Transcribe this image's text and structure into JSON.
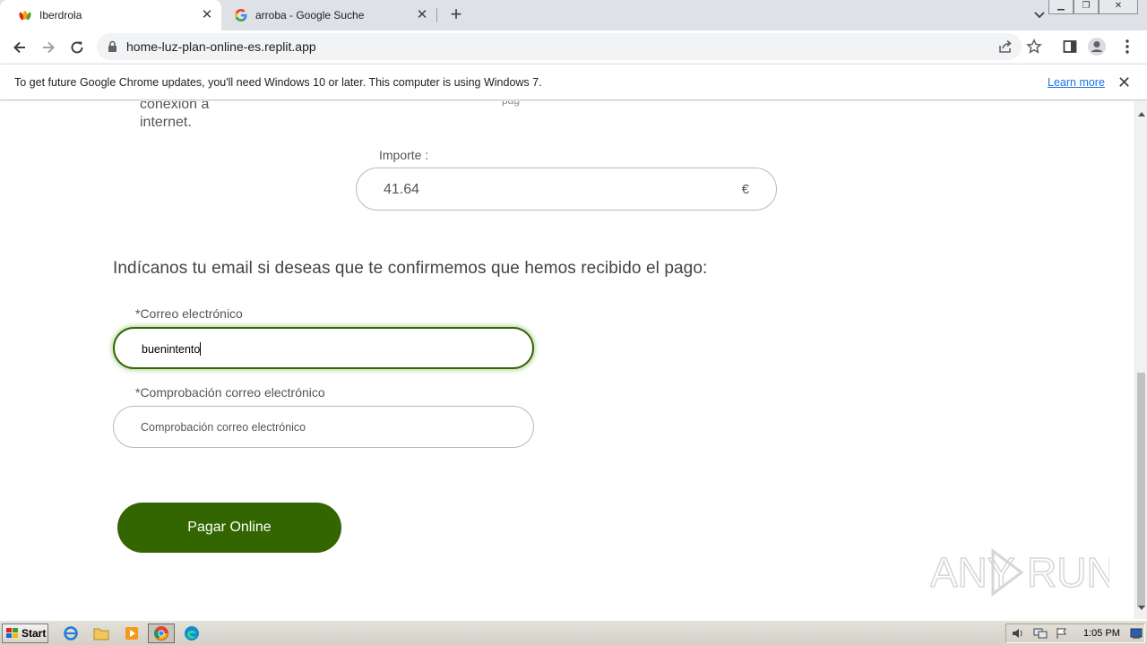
{
  "browser": {
    "tabs": [
      {
        "title": "Iberdrola",
        "active": true,
        "favicon": "iberdrola-logo-icon"
      },
      {
        "title": "arroba - Google Suche",
        "active": false,
        "favicon": "google-g-icon"
      }
    ],
    "new_tab_label": "+",
    "address_bar": {
      "url": "home-luz-plan-online-es.replit.app"
    },
    "infobar": {
      "message": "To get future Google Chrome updates, you'll need Windows 10 or later. This computer is using Windows 7.",
      "link_label": "Learn more"
    }
  },
  "page": {
    "fragment_text": "conexión a internet.",
    "importe": {
      "label": "Importe :",
      "value": "41.64",
      "currency": "€"
    },
    "email_prompt": "Indícanos tu email si deseas que te confirmemos que hemos recibido el pago:",
    "email_field": {
      "label": "*Correo electrónico",
      "value": "buenintento"
    },
    "email_confirm_field": {
      "label": "*Comprobación correo electrónico",
      "placeholder": "Comprobación correo electrónico"
    },
    "pay_button": "Pagar Online",
    "watermark": "ANY RUN"
  },
  "taskbar": {
    "start_label": "Start",
    "clock": "1:05 PM",
    "icons": [
      "internet-explorer-icon",
      "file-explorer-icon",
      "media-player-icon",
      "chrome-icon",
      "edge-icon"
    ]
  },
  "colors": {
    "brand_green": "#336600",
    "focus_glow": "#66aa33",
    "link_blue": "#1a73e8"
  }
}
